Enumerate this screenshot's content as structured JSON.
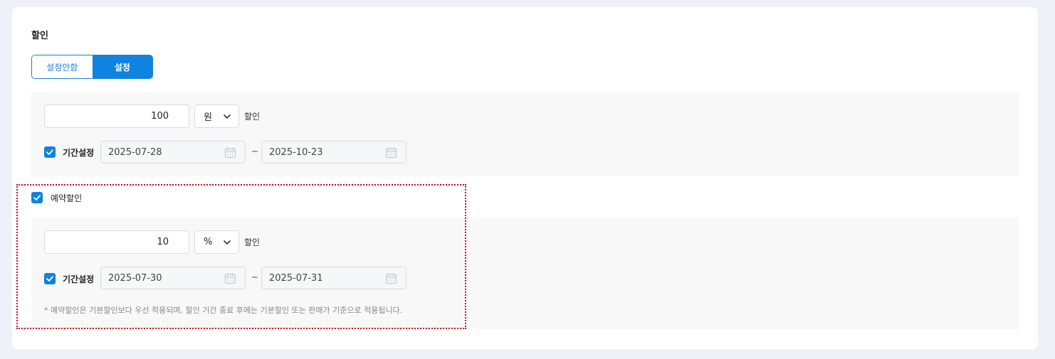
{
  "section": {
    "title": "할인"
  },
  "toggle": {
    "off_label": "설정안함",
    "on_label": "설정",
    "selected": "설정"
  },
  "discount": {
    "amount": "100",
    "unit": "원",
    "unit_suffix": "할인",
    "period_checked": true,
    "period_label": "기간설정",
    "start_date": "2025-07-28",
    "end_date": "2025-10-23",
    "separator": "~"
  },
  "reservation": {
    "checked": true,
    "label": "예약할인",
    "amount": "10",
    "unit": "%",
    "unit_suffix": "할인",
    "period_checked": true,
    "period_label": "기간설정",
    "start_date": "2025-07-30",
    "end_date": "2025-07-31",
    "separator": "~",
    "note": "* 예약할인은 기본할인보다 우선 적용되며, 할인 기간 종료 후에는 기본할인 또는 판매가 기준으로 적용됩니다."
  },
  "colors": {
    "accent": "#0f83e0",
    "highlight_border": "#d0021b",
    "background": "#eef1f7"
  },
  "icons": {
    "checkbox": "check-icon",
    "select": "chevron-down-icon",
    "date": "calendar-icon"
  }
}
